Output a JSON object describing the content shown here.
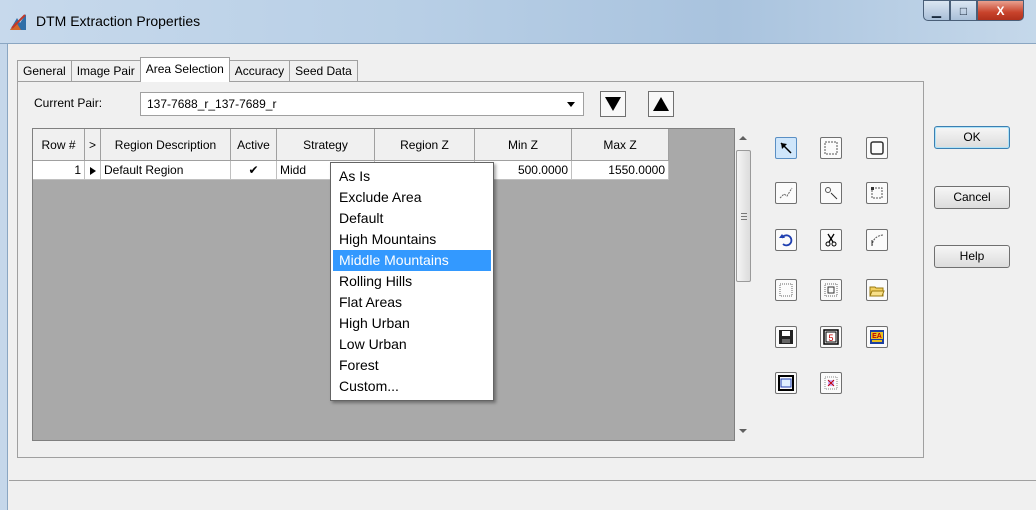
{
  "window": {
    "title": "DTM Extraction Properties",
    "min_symbol": "▁",
    "max_symbol": "□",
    "close_symbol": "X"
  },
  "tabs": [
    {
      "label": "General",
      "active": false
    },
    {
      "label": "Image Pair",
      "active": false
    },
    {
      "label": "Area Selection",
      "active": true
    },
    {
      "label": "Accuracy",
      "active": false
    },
    {
      "label": "Seed Data",
      "active": false
    }
  ],
  "pair": {
    "label": "Current Pair:",
    "value": "137-7688_r_137-7689_r"
  },
  "grid": {
    "headers": [
      "Row #",
      ">",
      "Region Description",
      "Active",
      "Strategy",
      "Region Z",
      "Min Z",
      "Max Z"
    ],
    "rows": [
      {
        "row_num": "1",
        "description": "Default Region",
        "active": "✔",
        "strategy": "Midd",
        "region_z": "",
        "min_z": "500.0000",
        "max_z": "1550.0000"
      }
    ]
  },
  "strategy_dropdown": {
    "items": [
      "As Is",
      "Exclude Area",
      "Default",
      "High Mountains",
      "Middle Mountains",
      "Rolling Hills",
      "Flat Areas",
      "High Urban",
      "Low Urban",
      "Forest",
      "Custom..."
    ],
    "selected": "Middle Mountains"
  },
  "tools": [
    "select-arrow-icon",
    "select-region-icon",
    "rectangle-icon",
    "polyline-icon",
    "point-select-icon",
    "edit-region-icon",
    "undo-icon",
    "cut-icon",
    "curve-icon",
    "dotted-rectangle-icon",
    "grid-region-icon",
    "open-folder-icon",
    "save-icon",
    "number-icon",
    "text-region-icon",
    "window-icon",
    "delete-region-icon"
  ],
  "buttons": {
    "ok": "OK",
    "cancel": "Cancel",
    "help": "Help"
  },
  "colors": {
    "selection": "#3399ff",
    "grid_background": "#a9a9a9",
    "window_background": "#f0f0f0"
  }
}
